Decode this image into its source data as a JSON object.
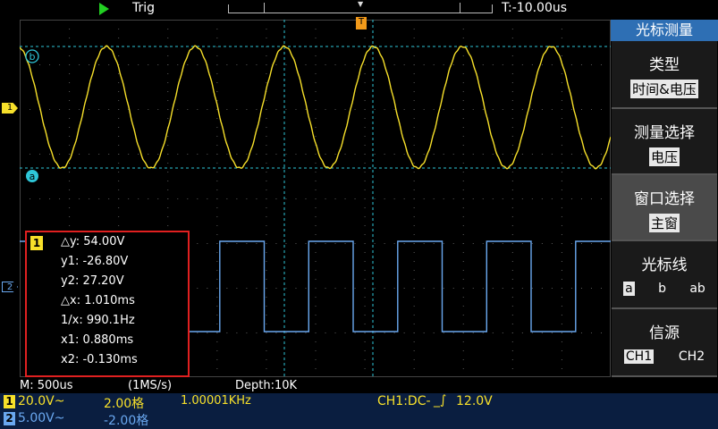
{
  "top": {
    "trig_label": "Trig",
    "time_delay": "T:-10.00us",
    "trig_pos_marker": "T"
  },
  "channels": {
    "ch1_marker": "1",
    "ch2_marker": "2",
    "cursor_a": "a",
    "cursor_b": "b"
  },
  "measure": {
    "badge": "1",
    "dy": "△y: 54.00V",
    "y1": "y1: -26.80V",
    "y2": "y2: 27.20V",
    "dx": "△x: 1.010ms",
    "inv_x": "1/x: 990.1Hz",
    "x1": "x1: 0.880ms",
    "x2": "x2: -0.130ms"
  },
  "timebase": {
    "m": "M: 500us",
    "rate": "(1MS/s)",
    "depth": "Depth:10K"
  },
  "status": {
    "ch1_badge": "1",
    "ch1_volts": "20.0V~",
    "ch1_pos": "2.00格",
    "ch1_freq": "1.00001KHz",
    "trigger": "CH1:DC-",
    "trigger_level": "12.0V",
    "ch2_badge": "2",
    "ch2_volts": "5.00V~",
    "ch2_pos": "-2.00格"
  },
  "menu": {
    "title": "光标测量",
    "items": [
      {
        "label": "类型",
        "value": "时间&电压"
      },
      {
        "label": "测量选择",
        "value": "电压"
      },
      {
        "label": "窗口选择",
        "value": "主窗"
      },
      {
        "label": "光标线",
        "options": [
          "a",
          "b",
          "ab"
        ],
        "selected": 0
      },
      {
        "label": "信源",
        "options": [
          "CH1",
          "CH2"
        ],
        "selected": 0
      }
    ]
  },
  "colors": {
    "ch1": "#f7e02a",
    "ch2": "#6aa8f0",
    "cursor": "#2ec6d8",
    "grid": "#5a5a5a",
    "menu_title_bg": "#2e6fb4",
    "status_bg": "#0a1e40",
    "measure_border": "#e02020",
    "trigger_marker": "#f29a1a"
  }
}
